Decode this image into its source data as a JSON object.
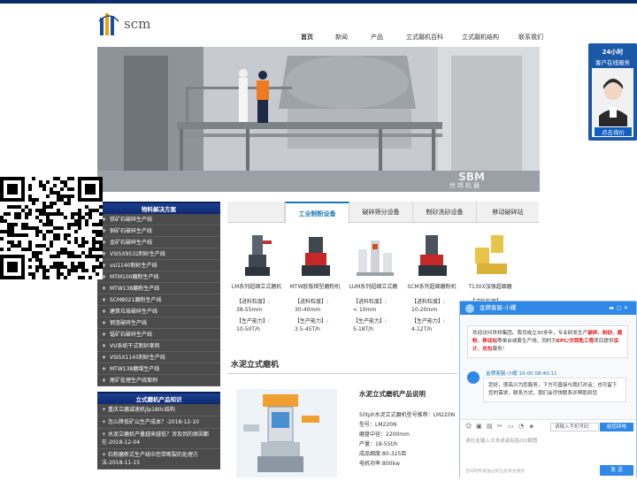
{
  "brand": {
    "logo_text": "scm"
  },
  "nav": {
    "items": [
      {
        "label": "首页",
        "active": true
      },
      {
        "label": "新闻",
        "active": false
      },
      {
        "label": "产品",
        "active": false
      },
      {
        "label": "立式磨机百科",
        "active": false
      },
      {
        "label": "立式磨机结构",
        "active": false
      },
      {
        "label": "联系我们",
        "active": false
      }
    ]
  },
  "banner": {
    "watermark": "SBM",
    "watermark_sub": "世邦机器"
  },
  "sidebar": {
    "solutions_title": "物料解决方案",
    "solutions": [
      "铁矿石破碎生产线",
      "铜矿石破碎生产线",
      "金矿石破碎生产线",
      "VSI5X9532制砂生产线",
      "vsi1140制砂生产线",
      "MTM100磨粉生产线",
      "MTW138磨粉生产线",
      "SCM8021磨粉生产线",
      "建筑垃圾破碎生产线",
      "钢渣破碎生产线",
      "锰矿石破碎生产线",
      "VU系统干式制砂案例",
      "VSI5X1145制砂生产线",
      "MTW138磨煤生产线",
      "尾矿处理生产线案例"
    ],
    "knowledge_title": "立式磨机产品知识",
    "knowledge": [
      "重庆立磨减速机jlp180c结构",
      "怎么降低矿山生产成本？-2018-12-10",
      "水泥立磨机产量越来越低？涉及到的原因都在-2018-12-04",
      "石粉磨新式生产线中您带断裂的处理方法-2018-11-15"
    ]
  },
  "tabs": [
    {
      "label": "工业制粉设备",
      "active": true
    },
    {
      "label": "破碎筛分设备",
      "active": false
    },
    {
      "label": "制砂洗砂设备",
      "active": false
    },
    {
      "label": "移动破碎站",
      "active": false
    }
  ],
  "products": [
    {
      "name": "LM系列超细立式磨机",
      "spec1_label": "【进料粒度】:",
      "spec1_value": "38-55mm",
      "spec2_label": "【生产能力】:",
      "spec2_value": "10-50T/h"
    },
    {
      "name": "MTW欧版梯型磨粉机",
      "spec1_label": "【进料粒度】:",
      "spec1_value": "30-40mm",
      "spec2_label": "【生产能力】:",
      "spec2_value": "3.5-45T/h"
    },
    {
      "name": "LUM系列超细立式磨",
      "spec1_label": "【进料粒度】:",
      "spec1_value": "< 10mm",
      "spec2_label": "【生产能力】:",
      "spec2_value": "5-18T/h"
    },
    {
      "name": "SCM系列超细磨粉机",
      "spec1_label": "【进料粒度】:",
      "spec1_value": "10-20mm",
      "spec2_label": "【生产能力】:",
      "spec2_value": "4-12T/h"
    },
    {
      "name": "T130X加强超细磨",
      "spec1_label": "【进料粒度】:",
      "spec1_value": "",
      "spec2_label": "",
      "spec2_value": ""
    }
  ],
  "section": {
    "title": "水泥立式磨机"
  },
  "mill_desc": {
    "title": "水泥立式磨机产品说明",
    "lines": [
      "50tph水泥立式磨机型号推荐：LM220N",
      "型号：LM220N",
      "磨盘中径：2200mm",
      "产量：18-55t/h",
      "成品细度:80-325目",
      "电机功率:800kw"
    ]
  },
  "service_widget": {
    "line1": "24小时",
    "line2": "客户在线服务",
    "button": "点击询价"
  },
  "chat": {
    "header": "金牌客服-小耀",
    "welcome": [
      {
        "t": "欢迎访问世邦集团。我司成立30多年，专业研发生产",
        "hl": false
      },
      {
        "t": "破碎、制砂、磨粉、移动站",
        "hl": true
      },
      {
        "t": "等单台或套生产线，同时为",
        "hl": false
      },
      {
        "t": "EPC/交钥匙工程",
        "hl": true
      },
      {
        "t": "项目提供",
        "hl": false
      },
      {
        "t": "设计、总包",
        "hl": true
      },
      {
        "t": "服务！",
        "hl": false
      }
    ],
    "agent_meta": "金牌客服-小耀  10-05 08:40:11",
    "agent_msg": "您好，很高兴为您服务，下方可直接与我们对话；也可留下您的需求、联系方式，我们会尽快联系并帮助到您",
    "phone_placeholder": "请输入手机号码",
    "callback_label": "给您回电",
    "input_placeholder": "请在此输入文本或者粘贴QQ截图",
    "footer_tip": "咨询时所发送过的信息将会保存",
    "send_label": "发 送"
  }
}
